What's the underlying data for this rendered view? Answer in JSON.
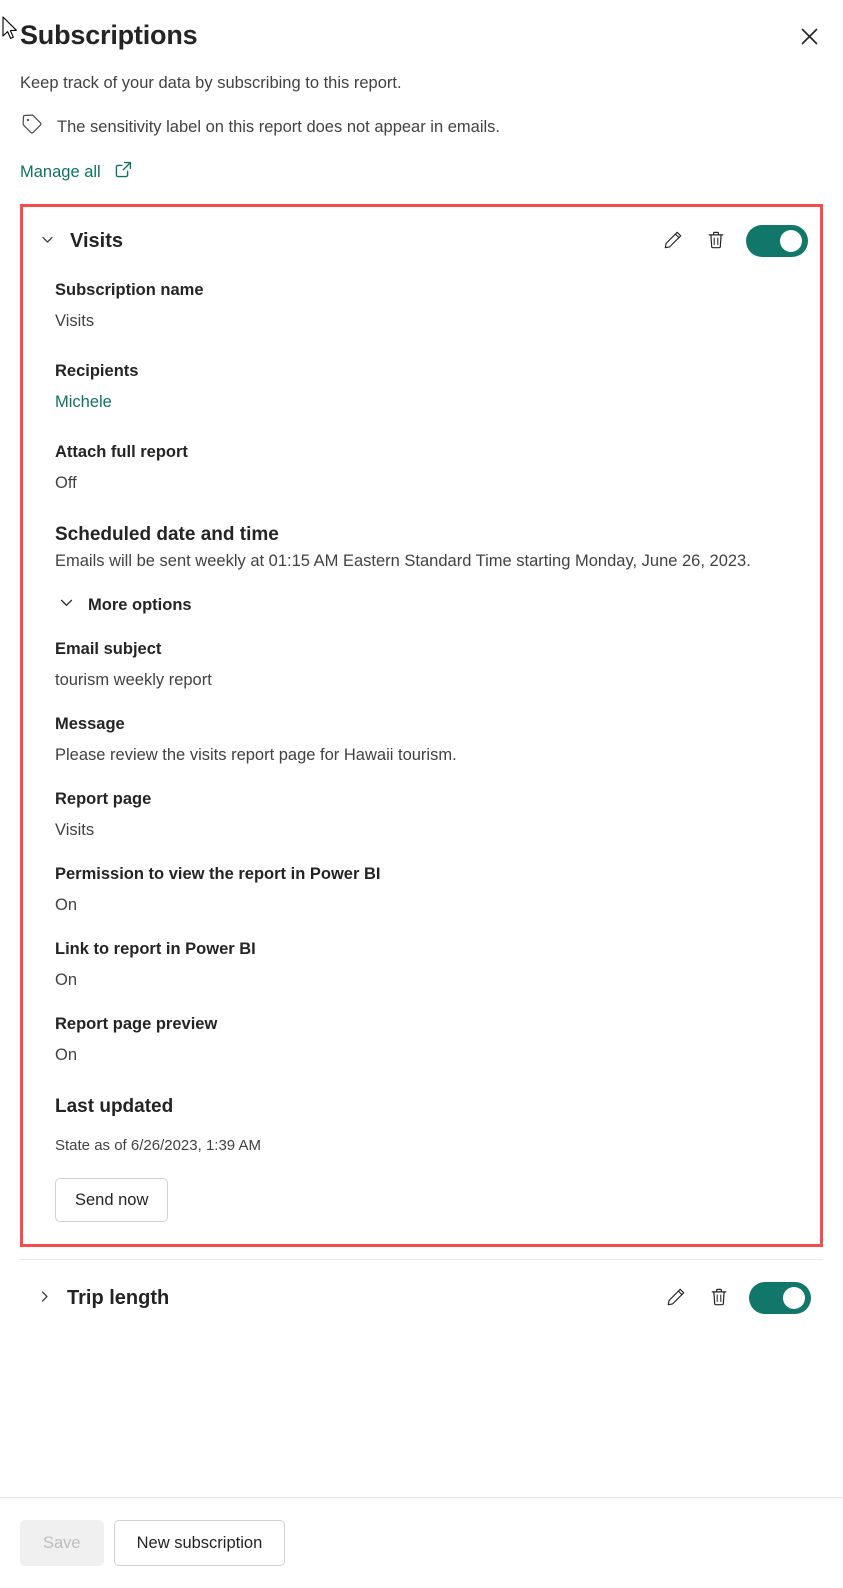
{
  "header": {
    "title": "Subscriptions",
    "close_icon": "close-icon",
    "subtitle": "Keep track of your data by subscribing to this report.",
    "sensitivity_icon": "tag-icon",
    "sensitivity_text": "The sensitivity label on this report does not appear in emails.",
    "manage_all_label": "Manage all",
    "manage_all_icon": "external-link-icon"
  },
  "colors": {
    "accent_teal": "#0f7362",
    "toggle_on": "#10776a",
    "highlight_border": "#fa4b4b",
    "text_primary": "#242424",
    "text_secondary": "#424242"
  },
  "subscriptions": [
    {
      "name": "Visits",
      "expanded": true,
      "highlighted": true,
      "chevron_icon": "chevron-down-icon",
      "edit_icon": "pencil-icon",
      "delete_icon": "trash-icon",
      "toggle_state": "On",
      "fields": {
        "subscription_name_label": "Subscription name",
        "subscription_name_value": "Visits",
        "recipients_label": "Recipients",
        "recipients_value": "Michele",
        "attach_full_report_label": "Attach full report",
        "attach_full_report_value": "Off",
        "scheduled_label": "Scheduled date and time",
        "scheduled_value": "Emails will be sent weekly at 01:15 AM Eastern Standard Time starting Monday, June 26, 2023.",
        "more_options_label": "More options",
        "more_options_icon": "chevron-down-icon",
        "email_subject_label": "Email subject",
        "email_subject_value": "tourism weekly report",
        "message_label": "Message",
        "message_value": "Please review the visits report page for Hawaii tourism.",
        "report_page_label": "Report page",
        "report_page_value": "Visits",
        "permission_label": "Permission to view the report in Power BI",
        "permission_value": "On",
        "link_label": "Link to report in Power BI",
        "link_value": "On",
        "preview_label": "Report page preview",
        "preview_value": "On",
        "last_updated_label": "Last updated",
        "last_updated_value": "State as of 6/26/2023, 1:39 AM",
        "send_now_label": "Send now"
      }
    },
    {
      "name": "Trip length",
      "expanded": false,
      "highlighted": false,
      "chevron_icon": "chevron-right-icon",
      "edit_icon": "pencil-icon",
      "delete_icon": "trash-icon",
      "toggle_state": "On"
    }
  ],
  "footer": {
    "save_label": "Save",
    "save_disabled": true,
    "new_subscription_label": "New subscription"
  }
}
